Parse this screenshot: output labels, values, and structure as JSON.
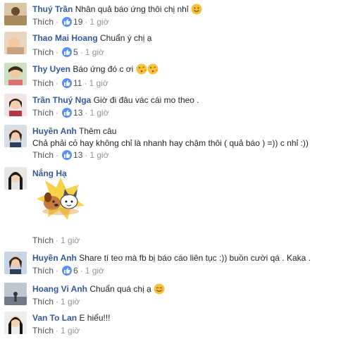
{
  "comments": [
    {
      "name": "Thuý Trần",
      "text": "Nhân quả báo ứng thôi chị nhỉ",
      "emoji": "smile",
      "like": "Thích",
      "likes": "19",
      "time": "1 giờ"
    },
    {
      "name": "Thao Mai Hoang",
      "text": "Chuẩn ý chị ạ",
      "like": "Thích",
      "likes": "5",
      "time": "1 giờ"
    },
    {
      "name": "Thy Uyen",
      "text": "Báo ứng đó c ơi",
      "emoji": "kiss-kiss",
      "like": "Thích",
      "likes": "11",
      "time": "1 giờ"
    },
    {
      "name": "Trần Thuý Nga",
      "text": "Giờ đi đâu vác cái mo theo .",
      "like": "Thích",
      "likes": "13",
      "time": "1 giờ"
    },
    {
      "name": "Huyền Anh",
      "text": "Thêm câu",
      "text2": "Chả phải cỏ hay không chỉ là nhanh hay chậm thôi ( quả báo ) =)) c nhỉ :))",
      "like": "Thích",
      "likes": "13",
      "time": "1 giờ"
    },
    {
      "name": "Nắng Hạ",
      "text": "",
      "sticker": "dog-cat-sticker",
      "like": "Thích",
      "time": "1 giờ"
    },
    {
      "name": "Huyền Anh",
      "text": "Share tí teo mà fb bị báo cáo liên tục :)) buồn cười qá . Kaka .",
      "like": "Thích",
      "likes": "6",
      "time": "1 giờ"
    },
    {
      "name": "Hoang Vi Anh",
      "text": "Chuẩn quá chị ạ",
      "emoji": "smile",
      "like": "Thích",
      "time": "1 giờ"
    },
    {
      "name": "Van To Lan",
      "text": "E hiểu!!!",
      "like": "Thích",
      "time": "1 giờ"
    }
  ],
  "colors": {
    "name": "#365899",
    "meta": "#90949c",
    "like_badge": "#5890ff"
  }
}
